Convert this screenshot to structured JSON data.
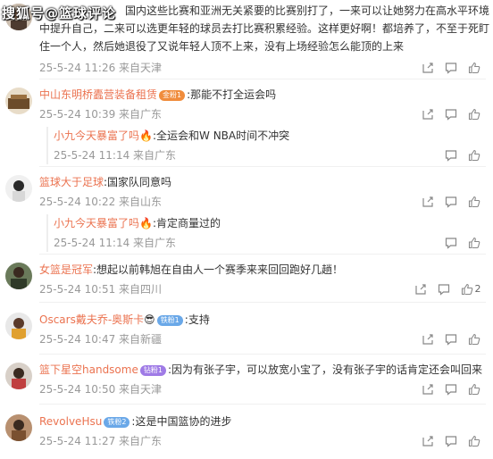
{
  "watermark": "搜狐号@篮球评论",
  "comments": [
    {
      "line1": "国内这些比赛和亚洲无关紧要的比赛别打了，一来可以让她努力在高水平环境",
      "line2": "中提升自己，二来可以选更年轻的球员去打比赛积累经验。这样更好啊！都培养了，不至于死盯",
      "line3": "住一个人，然后她退役了又说年轻人顶不上来，没有上场经验怎么能顶的上来",
      "meta": "25-5-24 11:26 来自天津"
    },
    {
      "user": "中山东明桥蠹营装备租赁",
      "badge": "金粉1",
      "text": ":那能不打全运会吗",
      "meta": "25-5-24 10:39 来自广东",
      "reply": {
        "user": "小九今天暴富了吗",
        "text": ":全运会和W NBA时间不冲突",
        "meta": "25-5-24 11:14 来自广东"
      }
    },
    {
      "user": "篮球大于足球",
      "text": ":国家队同意吗",
      "meta": "25-5-24 10:22 来自山东",
      "reply": {
        "user": "小九今天暴富了吗",
        "text": ":肯定商量过的",
        "meta": "25-5-24 11:14 来自广东"
      }
    },
    {
      "user": "女篮是冠军",
      "text": ":想起以前韩旭在自由人一个赛季来来回回跑好几趟！",
      "meta": "25-5-24 10:51 来自四川",
      "likes": "2"
    },
    {
      "user": "Oscars戴夫乔-奥斯卡",
      "badge": "铁粉1",
      "text": ":支持",
      "meta": "25-5-24 10:47 来自新疆"
    },
    {
      "user": "篮下星空handsome",
      "badge": "钻粉1",
      "text": ":因为有张子宇，可以放宽小宝了，没有张子宇的话肯定还会叫回来",
      "meta": "25-5-24 10:50 来自天津"
    },
    {
      "user": "RevolveHsu",
      "badge": "铁粉2",
      "text": ":这是中国篮协的进步",
      "meta": "25-5-24 11:27 来自广东"
    }
  ]
}
